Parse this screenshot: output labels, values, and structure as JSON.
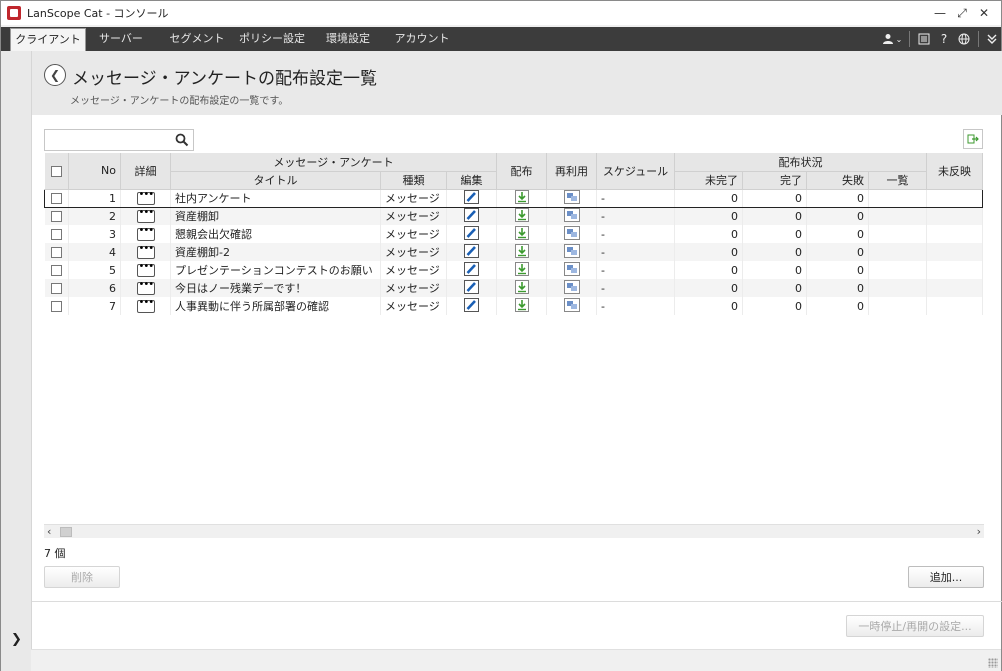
{
  "window": {
    "title": "LanScope Cat - コンソール"
  },
  "nav": {
    "tabs": [
      {
        "label": "クライアント",
        "active": true
      },
      {
        "label": "サーバー"
      },
      {
        "label": "セグメント"
      },
      {
        "label": "ポリシー設定"
      },
      {
        "label": "環境設定"
      },
      {
        "label": "アカウント"
      }
    ],
    "icons": [
      "user-icon",
      "list-icon",
      "help-icon",
      "globe-icon",
      "expand-icon"
    ],
    "help_label": "?"
  },
  "page": {
    "title": "メッセージ・アンケートの配布設定一覧",
    "subtitle": "メッセージ・アンケートの配布設定の一覧です。"
  },
  "search": {
    "placeholder": ""
  },
  "table": {
    "group_headers": {
      "message_survey": "メッセージ・アンケート",
      "dist_status": "配布状況"
    },
    "headers": {
      "no": "No",
      "detail": "詳細",
      "title": "タイトル",
      "type": "種類",
      "edit": "編集",
      "distribute": "配布",
      "reuse": "再利用",
      "schedule": "スケジュール",
      "incomplete": "未完了",
      "complete": "完了",
      "failed": "失敗",
      "list": "一覧",
      "unreflected": "未反映"
    },
    "rows": [
      {
        "no": "1",
        "title": "社内アンケート",
        "type": "メッセージ",
        "schedule": "-",
        "incomplete": "0",
        "complete": "0",
        "failed": "0"
      },
      {
        "no": "2",
        "title": "資産棚卸",
        "type": "メッセージ",
        "schedule": "-",
        "incomplete": "0",
        "complete": "0",
        "failed": "0"
      },
      {
        "no": "3",
        "title": "懇親会出欠確認",
        "type": "メッセージ",
        "schedule": "-",
        "incomplete": "0",
        "complete": "0",
        "failed": "0"
      },
      {
        "no": "4",
        "title": "資産棚卸-2",
        "type": "メッセージ",
        "schedule": "-",
        "incomplete": "0",
        "complete": "0",
        "failed": "0"
      },
      {
        "no": "5",
        "title": "プレゼンテーションコンテストのお願い",
        "type": "メッセージ",
        "schedule": "-",
        "incomplete": "0",
        "complete": "0",
        "failed": "0"
      },
      {
        "no": "6",
        "title": "今日はノー残業デーです！",
        "type": "メッセージ",
        "schedule": "-",
        "incomplete": "0",
        "complete": "0",
        "failed": "0"
      },
      {
        "no": "7",
        "title": "人事異動に伴う所属部署の確認",
        "type": "メッセージ",
        "schedule": "-",
        "incomplete": "0",
        "complete": "0",
        "failed": "0"
      }
    ]
  },
  "footer": {
    "count_label": "7 個",
    "delete_label": "削除",
    "add_label": "追加...",
    "pause_label": "一時停止/再開の設定..."
  },
  "colors": {
    "nav_bg": "#3c3c3c",
    "edit_icon": "#1a5fb4",
    "dist_icon": "#3c9a2f"
  }
}
